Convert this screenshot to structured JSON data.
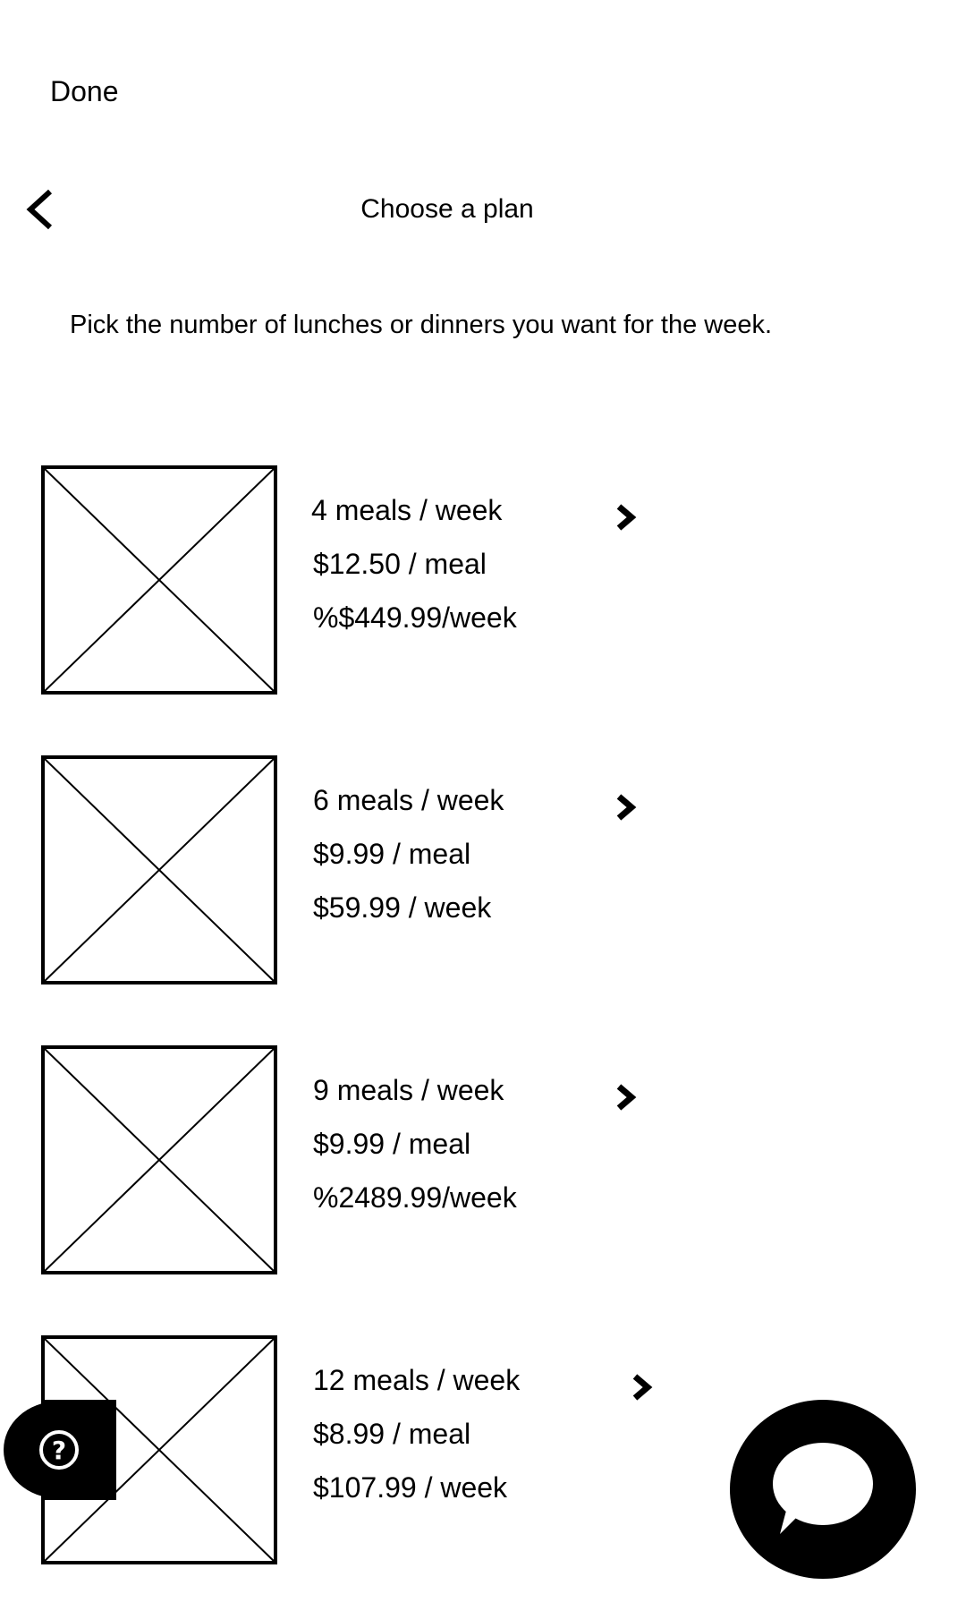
{
  "header": {
    "done_label": "Done",
    "title": "Choose a plan",
    "subtitle": "Pick the number of lunches or dinners you want for the week."
  },
  "plans": [
    {
      "meals": "4 meals / week",
      "per_meal": "$12.50 / meal",
      "per_week": "%$449.99/week"
    },
    {
      "meals": "6 meals / week",
      "per_meal": "$9.99 / meal",
      "per_week": "$59.99 / week"
    },
    {
      "meals": "9 meals / week",
      "per_meal": "$9.99 / meal",
      "per_week": "%2489.99/week"
    },
    {
      "meals": "12 meals / week",
      "per_meal": "$8.99 / meal",
      "per_week": "$107.99 / week"
    }
  ],
  "icons": {
    "back": "chevron-left-icon",
    "plan_arrow": "chevron-right-icon",
    "placeholder": "image-placeholder-icon",
    "help": "help-icon",
    "chat": "chat-icon"
  },
  "colors": {
    "background": "#ffffff",
    "foreground": "#000000"
  }
}
